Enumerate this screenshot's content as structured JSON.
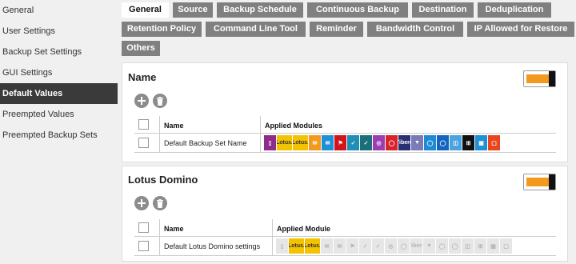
{
  "sidebar": {
    "items": [
      {
        "label": "General"
      },
      {
        "label": "User Settings"
      },
      {
        "label": "Backup Set Settings"
      },
      {
        "label": "GUI Settings"
      },
      {
        "label": "Default Values",
        "active": true
      },
      {
        "label": "Preempted Values"
      },
      {
        "label": "Preempted Backup Sets"
      }
    ]
  },
  "tabs": [
    {
      "label": "General",
      "active": true
    },
    {
      "label": "Source"
    },
    {
      "label": "Backup Schedule"
    },
    {
      "label": "Continuous Backup"
    },
    {
      "label": "Destination"
    },
    {
      "label": "Deduplication"
    },
    {
      "label": "Retention Policy"
    },
    {
      "label": "Command Line Tool"
    },
    {
      "label": "Reminder"
    },
    {
      "label": "Bandwidth Control"
    },
    {
      "label": "IP Allowed for Restore"
    },
    {
      "label": "Others"
    }
  ],
  "name_panel": {
    "title": "Name",
    "toggle_on": true,
    "header_name": "Name",
    "header_modules": "Applied Modules",
    "row_name": "Default Backup Set Name"
  },
  "lotus_panel": {
    "title": "Lotus Domino",
    "toggle_on": true,
    "header_name": "Name",
    "header_modules": "Applied Module",
    "row_name": "Default Lotus Domino settings"
  },
  "module_icons": [
    {
      "name": "file-icon",
      "glyph": "▯",
      "color": "#8e2c8c"
    },
    {
      "name": "lotus-domino-icon",
      "glyph": "Lotus.",
      "color": "#f4c300",
      "gold": true
    },
    {
      "name": "lotus-notes-icon",
      "glyph": "Lotus.",
      "color": "#f4c300",
      "gold": true
    },
    {
      "name": "exchange-icon",
      "glyph": "✉",
      "color": "#f39a1e"
    },
    {
      "name": "mail-icon",
      "glyph": "✉",
      "color": "#1e90d6"
    },
    {
      "name": "sql-server-icon",
      "glyph": "⚑",
      "color": "#d4141c"
    },
    {
      "name": "mysql-icon",
      "glyph": "✓",
      "color": "#1f8fb5"
    },
    {
      "name": "ms-sql-icon",
      "glyph": "✓",
      "color": "#1a6f7a"
    },
    {
      "name": "database-icon",
      "glyph": "◎",
      "color": "#9b3fb0"
    },
    {
      "name": "oracle-icon",
      "glyph": "◯",
      "color": "#d8232a"
    },
    {
      "name": "tibero-icon",
      "glyph": "Tibero",
      "color": "#2a2f74"
    },
    {
      "name": "shield-icon",
      "glyph": "▼",
      "color": "#7b7bb8"
    },
    {
      "name": "vmware-icon",
      "glyph": "◯",
      "color": "#1e8ad6"
    },
    {
      "name": "hyperv-icon",
      "glyph": "◯",
      "color": "#1565c0"
    },
    {
      "name": "cloud-icon",
      "glyph": "◫",
      "color": "#4aa3df"
    },
    {
      "name": "windows-icon",
      "glyph": "⊞",
      "color": "#111111"
    },
    {
      "name": "system-image-icon",
      "glyph": "▦",
      "color": "#1e90d6"
    },
    {
      "name": "office365-icon",
      "glyph": "▢",
      "color": "#e8461c"
    }
  ]
}
